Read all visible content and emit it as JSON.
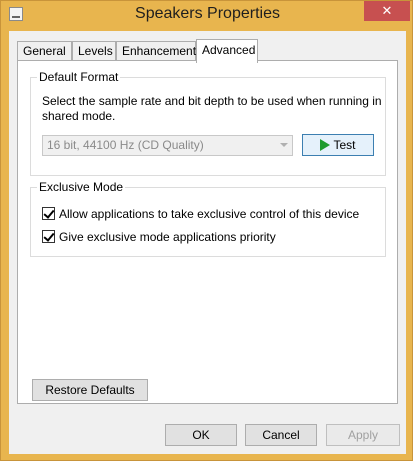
{
  "window": {
    "title": "Speakers Properties",
    "close_glyph": "✕"
  },
  "tabs": [
    {
      "label": "General"
    },
    {
      "label": "Levels"
    },
    {
      "label": "Enhancements"
    },
    {
      "label": "Advanced"
    }
  ],
  "default_format": {
    "heading": "Default Format",
    "description": "Select the sample rate and bit depth to be used when running in shared mode.",
    "format_selected": "16 bit, 44100 Hz (CD Quality)",
    "test_label": "Test"
  },
  "exclusive_mode": {
    "heading": "Exclusive Mode",
    "options": [
      {
        "label": "Allow applications to take exclusive control of this device",
        "checked": true
      },
      {
        "label": "Give exclusive mode applications priority",
        "checked": true
      }
    ]
  },
  "buttons": {
    "restore": "Restore Defaults",
    "ok": "OK",
    "cancel": "Cancel",
    "apply": "Apply"
  },
  "colors": {
    "frame": "#e8b54e",
    "close": "#c75050",
    "play": "#1f9b2e"
  }
}
